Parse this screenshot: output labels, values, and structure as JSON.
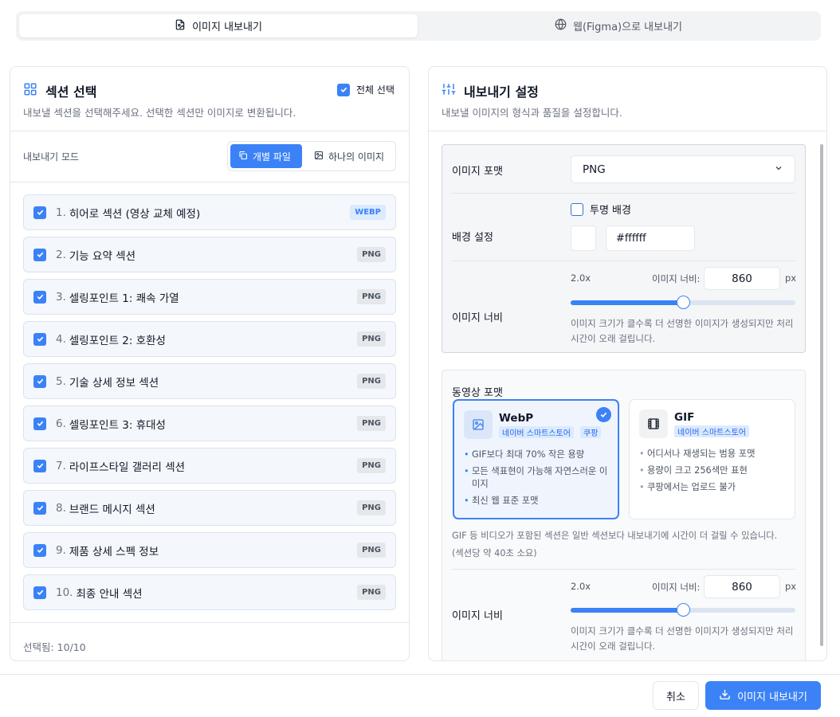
{
  "tabs": {
    "image_export": "이미지 내보내기",
    "web_export": "웹(Figma)으로 내보내기"
  },
  "left": {
    "title": "섹션 선택",
    "description": "내보낼 섹션을 선택해주세요. 선택한 섹션만 이미지로 변환됩니다.",
    "select_all": "전체 선택",
    "mode_label": "내보내기 모드",
    "mode_individual": "개별 파일",
    "mode_single": "하나의 이미지",
    "sections": [
      {
        "num": "1.",
        "name": "히어로 섹션 (영상 교체 예정)",
        "badge": "WEBP"
      },
      {
        "num": "2.",
        "name": "기능 요약 섹션",
        "badge": "PNG"
      },
      {
        "num": "3.",
        "name": "셀링포인트 1: 쾌속 가열",
        "badge": "PNG"
      },
      {
        "num": "4.",
        "name": "셀링포인트 2: 호환성",
        "badge": "PNG"
      },
      {
        "num": "5.",
        "name": "기술 상세 정보 섹션",
        "badge": "PNG"
      },
      {
        "num": "6.",
        "name": "셀링포인트 3: 휴대성",
        "badge": "PNG"
      },
      {
        "num": "7.",
        "name": "라이프스타일 갤러리 섹션",
        "badge": "PNG"
      },
      {
        "num": "8.",
        "name": "브랜드 메시지 섹션",
        "badge": "PNG"
      },
      {
        "num": "9.",
        "name": "제품 상세 스펙 정보",
        "badge": "PNG"
      },
      {
        "num": "10.",
        "name": "최종 안내 섹션",
        "badge": "PNG"
      }
    ],
    "selected_count": "선택됨: 10/10"
  },
  "right": {
    "title": "내보내기 설정",
    "description": "내보낼 이미지의 형식과 품질을 설정합니다.",
    "image_format_label": "이미지 포맷",
    "image_format_value": "PNG",
    "bg_label": "배경 설정",
    "transparent_label": "투명 배경",
    "bg_color_value": "#ffffff",
    "width_label": "이미지 너비",
    "scale": "2.0x",
    "width_field_label": "이미지 너비:",
    "width_value": "860",
    "unit": "px",
    "slider_level": 0.5,
    "width_help_1": "이미지 크기가 클수록 더 선명한 이미지가 생성되지만 처리",
    "width_help_2": "시간이 오래 걸립니다.",
    "video_format_label": "동영상 포맷",
    "webp": {
      "title": "WebP",
      "tags": [
        "네이버 스마트스토어",
        "쿠팡"
      ],
      "bullets": [
        "GIF보다 최대 70% 작은 용량",
        "모든 색표현이 가능해 자연스러운 이미지",
        "최신 웹 표준 포맷"
      ]
    },
    "gif": {
      "title": "GIF",
      "tags": [
        "네이버 스마트스토어"
      ],
      "bullets": [
        "어디서나 재생되는 범용 포맷",
        "용량이 크고 256색만 표현",
        "쿠팡에서는 업로드 불가"
      ]
    },
    "video_note_1": "GIF 등 비디오가 포함된 섹션은 일반 섹션보다 내보내기에 시간이 더 걸릴 수 있습니다.",
    "video_note_2": "(섹션당 약 40초 소요)",
    "width2_label": "이미지 너비",
    "scale2": "2.0x",
    "width2_field_label": "이미지 너비:",
    "width2_value": "860",
    "unit2": "px",
    "slider2_level": 0.5,
    "width2_help_1": "이미지 크기가 클수록 더 선명한 이미지가 생성되지만 처리",
    "width2_help_2": "시간이 오래 걸립니다."
  },
  "footer": {
    "cancel": "취소",
    "export": "이미지 내보내기"
  },
  "colors": {
    "accent": "#3b82f6"
  }
}
